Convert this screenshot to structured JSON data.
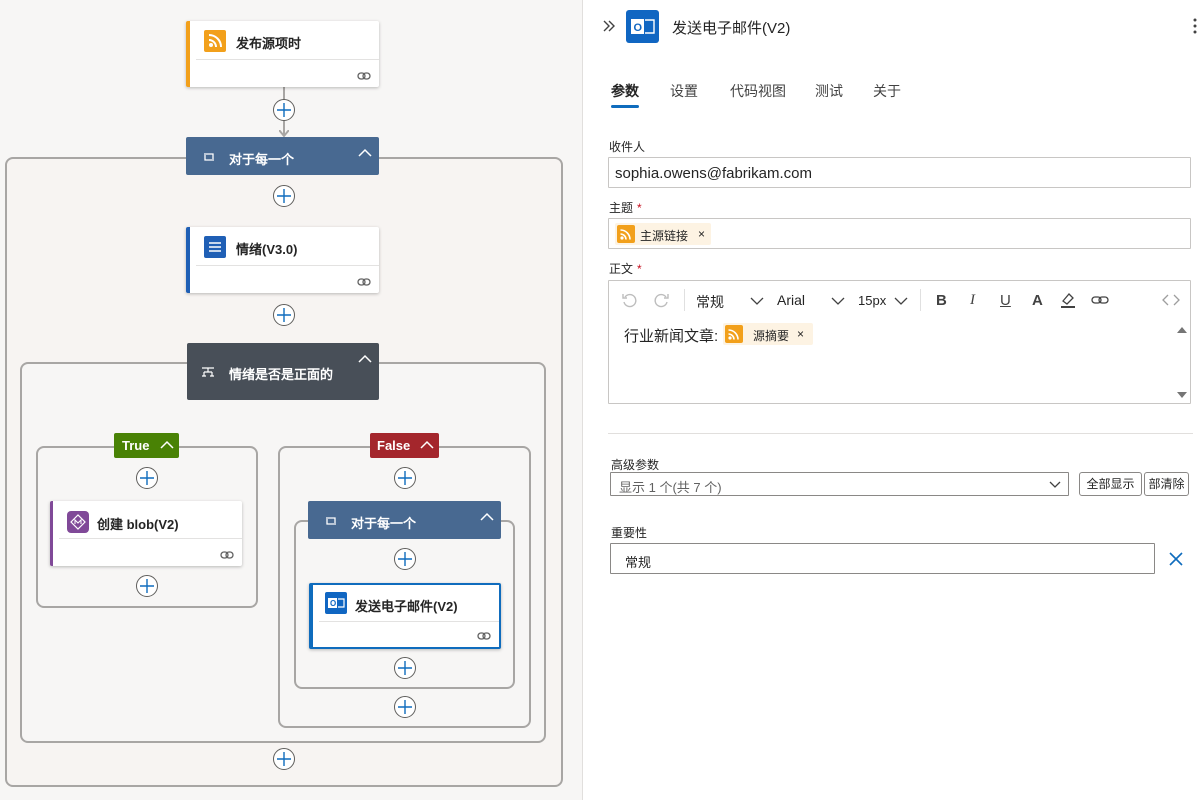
{
  "flow": {
    "trigger": {
      "title": "发布源项时"
    },
    "foreach_outer": {
      "title": "对于每一个"
    },
    "sentiment": {
      "title": "情绪(V3.0)"
    },
    "condition": {
      "title": "情绪是否是正面的"
    },
    "branch_true": {
      "label": "True"
    },
    "branch_false": {
      "label": "False"
    },
    "create_blob": {
      "title": "创建 blob(V2)"
    },
    "foreach_inner": {
      "title": "对于每一个"
    },
    "send_email": {
      "title": "发送电子邮件(V2)"
    }
  },
  "panel": {
    "title": "发送电子邮件(V2)",
    "tabs": [
      "参数",
      "设置",
      "代码视图",
      "测试",
      "关于"
    ],
    "active_tab": "参数",
    "to": {
      "label": "收件人",
      "value": "sophia.owens@fabrikam.com"
    },
    "subject": {
      "label": "主题",
      "required_mark": "*",
      "token": "主源链接",
      "token_remove": "×"
    },
    "body": {
      "label": "正文",
      "required_mark": "*",
      "style_select": "常规",
      "font_select": "Arial",
      "size_select": "15px",
      "text": "行业新闻文章:",
      "token": "源摘要",
      "token_remove": "×"
    },
    "advanced": {
      "label": "高级参数",
      "dropdown": "显示 1 个(共 7 个)",
      "show_all": "全部显示",
      "clear_all": "部清除"
    },
    "importance": {
      "label": "重要性",
      "value": "常规"
    }
  },
  "colors": {
    "accent": "#0f6cbd",
    "scope_header": "#486991",
    "condition_header": "#484f58",
    "true_green": "#498205",
    "false_red": "#a4262c",
    "rss_orange": "#f2a01b",
    "sentiment_blue": "#1f5fb5",
    "blob_purple": "#804998",
    "outlook_blue": "#1066c2"
  }
}
